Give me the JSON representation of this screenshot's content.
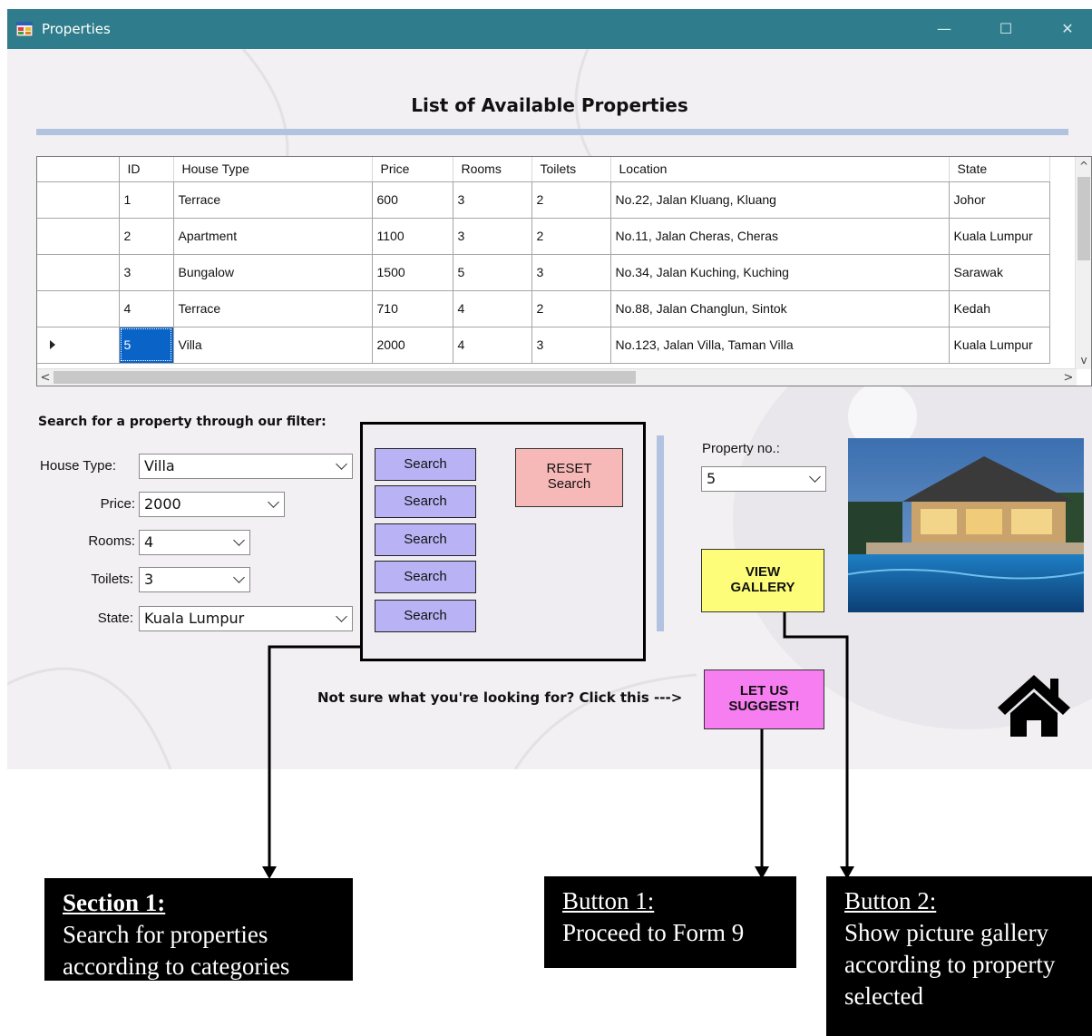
{
  "window": {
    "title": "Properties",
    "controls": {
      "minimize": "—",
      "maximize": "☐",
      "close": "✕"
    }
  },
  "heading": "List of Available Properties",
  "grid": {
    "columns": [
      "ID",
      "House Type",
      "Price",
      "Rooms",
      "Toilets",
      "Location",
      "State"
    ],
    "rows": [
      [
        "1",
        "Terrace",
        "600",
        "3",
        "2",
        "No.22, Jalan Kluang, Kluang",
        "Johor"
      ],
      [
        "2",
        "Apartment",
        "1100",
        "3",
        "2",
        "No.11, Jalan Cheras, Cheras",
        "Kuala Lumpur"
      ],
      [
        "3",
        "Bungalow",
        "1500",
        "5",
        "3",
        "No.34, Jalan Kuching, Kuching",
        "Sarawak"
      ],
      [
        "4",
        "Terrace",
        "710",
        "4",
        "2",
        "No.88, Jalan Changlun, Sintok",
        "Kedah"
      ],
      [
        "5",
        "Villa",
        "2000",
        "4",
        "3",
        "No.123, Jalan Villa, Taman Villa",
        "Kuala Lumpur"
      ]
    ],
    "selected_row": 5,
    "scroll": {
      "up": "^",
      "down": "v",
      "left": "<",
      "right": ">"
    }
  },
  "filter": {
    "title": "Search for a property through our filter:",
    "house_type": {
      "label": "House Type:",
      "value": "Villa"
    },
    "price": {
      "label": "Price:",
      "value": "2000"
    },
    "rooms": {
      "label": "Rooms:",
      "value": "4"
    },
    "toilets": {
      "label": "Toilets:",
      "value": "3"
    },
    "state": {
      "label": "State:",
      "value": "Kuala Lumpur"
    }
  },
  "buttons": {
    "search": "Search",
    "reset_line1": "RESET",
    "reset_line2": "Search",
    "gallery_line1": "VIEW",
    "gallery_line2": "GALLERY",
    "suggest_line1": "LET US",
    "suggest_line2": "SUGGEST!"
  },
  "property_no": {
    "label": "Property no.:",
    "value": "5"
  },
  "not_sure": "Not sure what you're looking for? Click this --->",
  "icons": {
    "home": "home-icon",
    "photo": "villa-pool-photo"
  },
  "colors": {
    "titlebar": "#2f7d8c",
    "search_button": "#b9b3f5",
    "reset_button": "#f7b8b8",
    "gallery_button": "#fdfd7a",
    "suggest_button": "#f67ef1",
    "accent_bar": "#b1c3e0",
    "selection": "#0a64c8"
  },
  "annotations": {
    "section1": {
      "title": "Section 1:",
      "line1": "Search for properties",
      "line2": "according to categories"
    },
    "button1": {
      "title": "Button 1:",
      "line1": "Proceed to Form 9"
    },
    "button2": {
      "title": "Button 2:",
      "line1": "Show picture gallery",
      "line2": "according to property",
      "line3": "selected"
    }
  }
}
